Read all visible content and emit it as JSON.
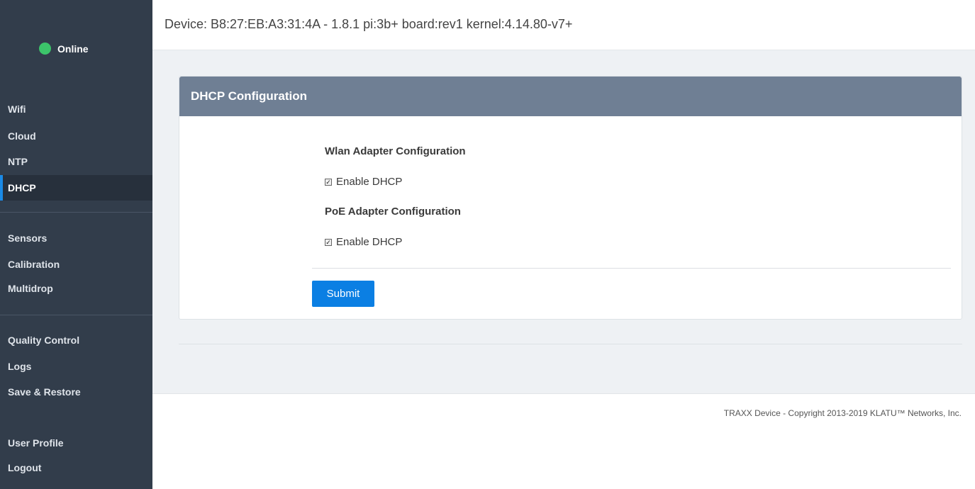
{
  "status": {
    "label": "Online",
    "color": "#3cc46a"
  },
  "device": {
    "title": "Device: B8:27:EB:A3:31:4A - 1.8.1 pi:3b+ board:rev1 kernel:4.14.80-v7+"
  },
  "sidebar": {
    "groups": [
      {
        "items": [
          {
            "label": "Wifi",
            "active": false
          },
          {
            "label": "Cloud",
            "active": false
          },
          {
            "label": "NTP",
            "active": false
          },
          {
            "label": "DHCP",
            "active": true
          }
        ]
      },
      {
        "items": [
          {
            "label": "Sensors",
            "active": false
          },
          {
            "label": "Calibration",
            "active": false
          },
          {
            "label": "Multidrop",
            "active": false
          }
        ]
      },
      {
        "items": [
          {
            "label": "Quality Control",
            "active": false
          },
          {
            "label": "Logs",
            "active": false
          },
          {
            "label": "Save & Restore",
            "active": false
          }
        ]
      },
      {
        "items": [
          {
            "label": "User Profile",
            "active": false
          },
          {
            "label": "Logout",
            "active": false
          }
        ]
      }
    ]
  },
  "panel": {
    "title": "DHCP Configuration",
    "wlan": {
      "title": "Wlan Adapter Configuration",
      "checkbox_label": "Enable DHCP",
      "checked": true
    },
    "poe": {
      "title": "PoE Adapter Configuration",
      "checkbox_label": "Enable DHCP",
      "checked": true
    },
    "submit_label": "Submit"
  },
  "footer": {
    "text": "TRAXX Device - Copyright 2013-2019 KLATU™ Networks, Inc."
  }
}
